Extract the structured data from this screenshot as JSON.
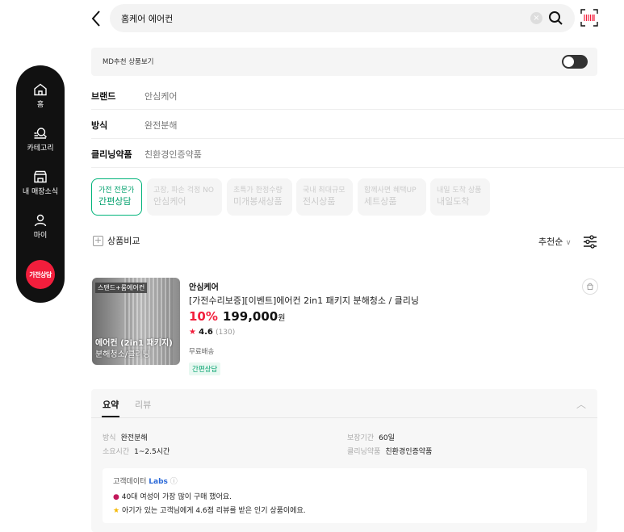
{
  "sidebar": {
    "items": [
      {
        "label": "홈"
      },
      {
        "label": "카테고리"
      },
      {
        "label": "내 매장소식"
      },
      {
        "label": "마이"
      }
    ],
    "cta_label": "가전상담"
  },
  "header": {
    "search_value": "홈케어 에어컨"
  },
  "md_bar": {
    "label": "MD추천 상품보기",
    "toggle_on": false
  },
  "filters": [
    {
      "key": "브랜드",
      "value": "안심케어"
    },
    {
      "key": "방식",
      "value": "완전분해"
    },
    {
      "key": "클리닝약품",
      "value": "친환경인증약품"
    }
  ],
  "chips": [
    {
      "line1": "가전 전문가",
      "line2": "간편상담",
      "active": true
    },
    {
      "line1": "고장, 파손 걱정 NO",
      "line2": "안심케어",
      "active": false
    },
    {
      "line1": "초특가 한정수량",
      "line2": "미개봉새상품",
      "active": false
    },
    {
      "line1": "국내 최대규모",
      "line2": "전시상품",
      "active": false
    },
    {
      "line1": "함께사면 혜택UP",
      "line2": "세트상품",
      "active": false
    },
    {
      "line1": "내일 도착 상품",
      "line2": "내일도착",
      "active": false
    }
  ],
  "list_controls": {
    "compare_label": "상품비교",
    "sort_label": "추천순"
  },
  "product": {
    "thumb_tag": "스탠드+룸에어컨",
    "thumb_line1": "에어컨 (2in1 패키지)",
    "thumb_line2": "분해청소/클리닝",
    "brand": "안심케어",
    "title": "[가전수리보증][이벤트]에어컨 2in1 패키지 분해청소 / 클리닝",
    "discount": "10%",
    "price": "199,000",
    "currency": "원",
    "rating": "4.6",
    "review_count": "(130)",
    "shipping": "무료배송",
    "badge": "간편상담"
  },
  "summary": {
    "tab_summary": "요약",
    "tab_review": "리뷰",
    "specs": [
      {
        "k": "방식",
        "v": "완전분해"
      },
      {
        "k": "보장기간",
        "v": "60일"
      },
      {
        "k": "소요시간",
        "v": "1~2.5시간"
      },
      {
        "k": "클리닝약품",
        "v": "친환경인증약품"
      }
    ],
    "insight_title": "고객데이터",
    "insight_labs": "Labs",
    "insight_lines": [
      "40대 여성이 가장 많이 구매 했어요.",
      "아기가 있는 고객님에게 4.6점 리뷰를 받은 인기 상품이에요."
    ]
  },
  "colors": {
    "accent_red": "#f21e3c",
    "accent_green": "#00a06c",
    "labs_blue": "#2c6ad8"
  }
}
